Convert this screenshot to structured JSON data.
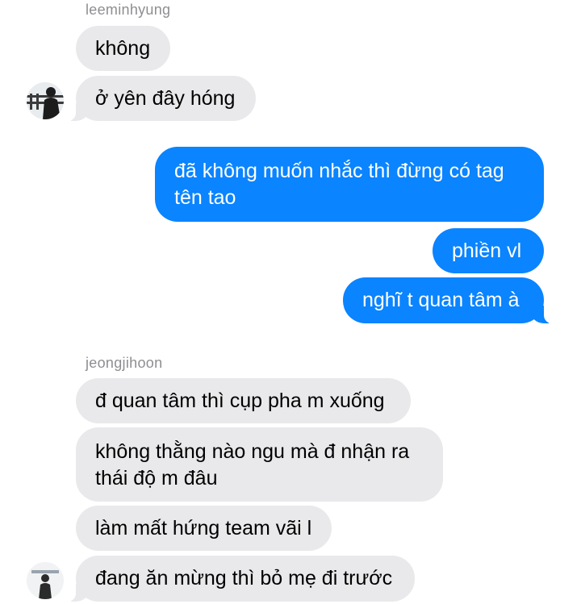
{
  "messages": [
    {
      "sender": "leeminhyung",
      "bubbles": [
        "không",
        "ở yên đây hóng"
      ]
    },
    {
      "sender": "me",
      "bubbles": [
        "đã không muốn nhắc thì đừng có tag tên tao",
        "phiền vl",
        "nghĩ t quan tâm à"
      ]
    },
    {
      "sender": "jeongjihoon",
      "bubbles": [
        "đ quan tâm thì cụp pha m xuống",
        "không thằng nào ngu mà đ nhận ra thái độ m đâu",
        "làm mất hứng team vãi l",
        "đang ăn mừng thì bỏ mẹ đi trước"
      ]
    }
  ],
  "colors": {
    "sent_bubble": "#0a84ff",
    "received_bubble": "#e9e9eb",
    "sender_label": "#8e8e93"
  }
}
